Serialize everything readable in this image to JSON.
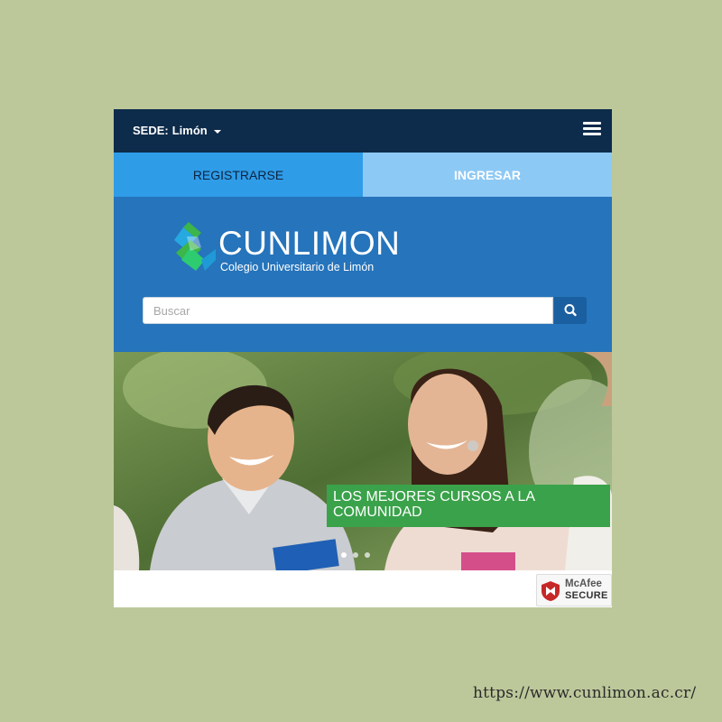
{
  "topbar": {
    "sede_label": "SEDE:",
    "sede_value": "Limón",
    "menu_icon": "hamburger-menu-icon"
  },
  "tabs": [
    {
      "label": "REGISTRARSE"
    },
    {
      "label": "INGRESAR"
    }
  ],
  "header": {
    "logo_name": "CUNLIMON",
    "logo_subtitle": "Colegio Universitario de Limón",
    "search_placeholder": "Buscar",
    "search_icon": "search-icon"
  },
  "hero": {
    "caption": "LOS MEJORES CURSOS A LA COMUNIDAD",
    "slide_count": 3,
    "active_slide": 1
  },
  "footer": {
    "badge_brand": "McAfee",
    "badge_label": "SECURE"
  },
  "page_url": "https://www.cunlimon.ac.cr/",
  "colors": {
    "background": "#bcc89a",
    "topbar": "#0d2b4a",
    "tab_register": "#2f9ce8",
    "tab_login": "#8dc9f5",
    "header": "#2674bb",
    "caption": "#3aa24a"
  }
}
